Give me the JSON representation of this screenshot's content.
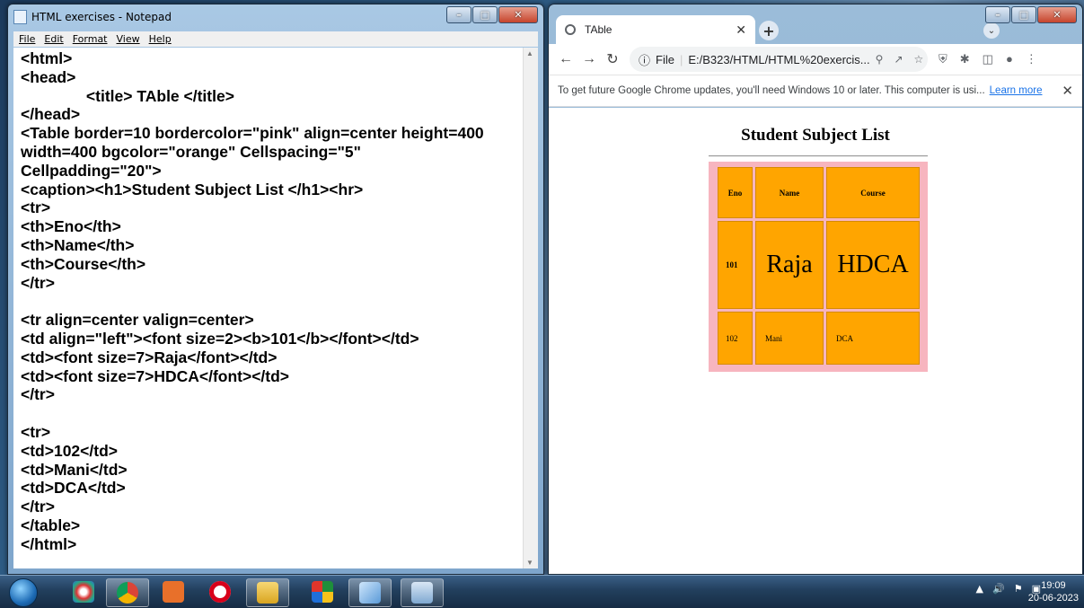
{
  "notepad": {
    "title": "HTML exercises - Notepad",
    "menu": [
      "File",
      "Edit",
      "Format",
      "View",
      "Help"
    ],
    "content": "<html>\n<head>\n               <title> TAble </title>\n</head>\n<Table border=10 bordercolor=\"pink\" align=center height=400\nwidth=400 bgcolor=\"orange\" Cellspacing=\"5\"\nCellpadding=\"20\">\n<caption><h1>Student Subject List </h1><hr>\n<tr>\n<th>Eno</th>\n<th>Name</th>\n<th>Course</th>\n</tr>\n\n<tr align=center valign=center>\n<td align=\"left\"><font size=2><b>101</b></font></td>\n<td><font size=7>Raja</font></td>\n<td><font size=7>HDCA</font></td>\n</tr>\n\n<tr>\n<td>102</td>\n<td>Mani</td>\n<td>DCA</td>\n</tr>\n</table>\n</html>"
  },
  "chrome": {
    "tab_title": "TAble",
    "url": "E:/B323/HTML/HTML%20exercis...",
    "url_scheme_label": "File",
    "infobar_text": "To get future Google Chrome updates, you'll need Windows 10 or later. This computer is usi...",
    "infobar_link": "Learn more",
    "page": {
      "caption": "Student Subject List",
      "headers": [
        "Eno",
        "Name",
        "Course"
      ],
      "rows": [
        [
          "101",
          "Raja",
          "HDCA"
        ],
        [
          "102",
          "Mani",
          "DCA"
        ]
      ],
      "table_bg": "#ffa500",
      "border_color": "#f7b5bf"
    }
  },
  "taskbar": {
    "time": "19:09",
    "date": "20-06-2023"
  }
}
